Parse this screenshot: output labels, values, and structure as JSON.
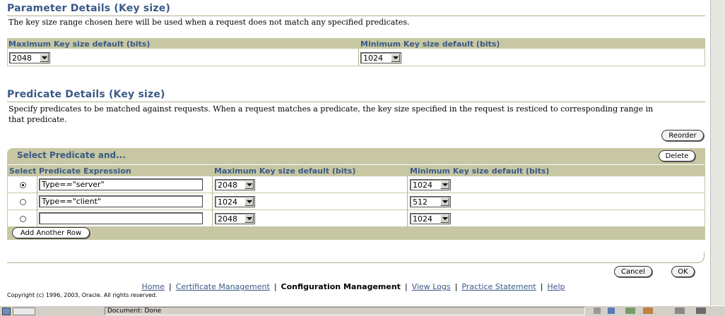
{
  "param": {
    "title": "Parameter Details (Key size)",
    "description": "The key size range chosen here will be used when a request does not match any specified predicates.",
    "max_label": "Maximum Key size default (bits)",
    "min_label": "Minimum Key size default (bits)",
    "max_value": "2048",
    "min_value": "1024"
  },
  "predicate": {
    "title": "Predicate Details (Key size)",
    "description_line1": "Specify predicates to be matched against requests. When a request matches a predicate, the key size specified in the request is resticed to corresponding range in",
    "description_line2": "that predicate.",
    "reorder_label": "Reorder",
    "bar_title": "Select Predicate and...",
    "delete_label": "Delete",
    "col_select": "Select",
    "col_expression": "Predicate Expression",
    "col_max": "Maximum Key size default (bits)",
    "col_min": "Minimum Key size default (bits)",
    "rows": [
      {
        "selected": true,
        "expression": "Type==\"server\"",
        "max": "2048",
        "min": "1024"
      },
      {
        "selected": false,
        "expression": "Type==\"client\"",
        "max": "1024",
        "min": "512"
      },
      {
        "selected": false,
        "expression": "",
        "max": "2048",
        "min": "1024"
      }
    ],
    "add_row_label": "Add Another Row"
  },
  "actions": {
    "cancel_label": "Cancel",
    "ok_label": "OK"
  },
  "footer": {
    "home": "Home",
    "cert_mgmt": "Certificate Management",
    "config_mgmt": "Configuration Management",
    "view_logs": "View Logs",
    "practice": "Practice Statement",
    "help": "Help",
    "copyright": "Copyright (c) 1996, 2003, Oracle. All rights reserved."
  },
  "status_bar": {
    "text": "Document: Done"
  }
}
